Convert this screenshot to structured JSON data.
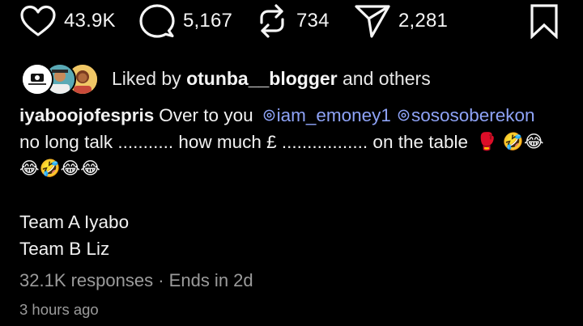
{
  "actions": {
    "likes": "43.9K",
    "comments": "5,167",
    "reposts": "734",
    "shares": "2,281"
  },
  "liked_by": {
    "prefix": "Liked by ",
    "user": "otunba__blogger",
    "suffix": " and others"
  },
  "post": {
    "username": "iyaboojofespris",
    "text_1": "Over to you ",
    "mention_1": "iam_emoney1",
    "mention_2": "sososoberekon",
    "line_2": "no long talk ........... how much £ ................. on the table",
    "line_2_emojis": "🥊 🤣😂",
    "line_3_emojis": "😂🤣😂😂",
    "line_4": "Team A Iyabo",
    "line_5": "Team B Liz"
  },
  "poll": {
    "responses": "32.1K responses",
    "separator": " · ",
    "ends": "Ends in 2d"
  },
  "timestamp": "3 hours ago",
  "colors": {
    "background": "#000000",
    "text": "#f5f5f5",
    "mention": "#8ea3f7",
    "muted": "#9b9b9b"
  }
}
